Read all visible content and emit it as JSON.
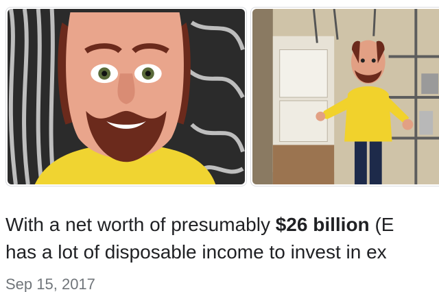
{
  "results": {
    "images": [
      {
        "label": "puppet-face-closeup"
      },
      {
        "label": "puppet-full-body-kitchen"
      }
    ],
    "snippet": {
      "line1_prefix": "With a net worth of presumably ",
      "line1_bold": "$26 billion",
      "line1_suffix": " (E",
      "line2": "has a lot of disposable income to invest in ex"
    },
    "date": "Sep 15, 2017"
  }
}
